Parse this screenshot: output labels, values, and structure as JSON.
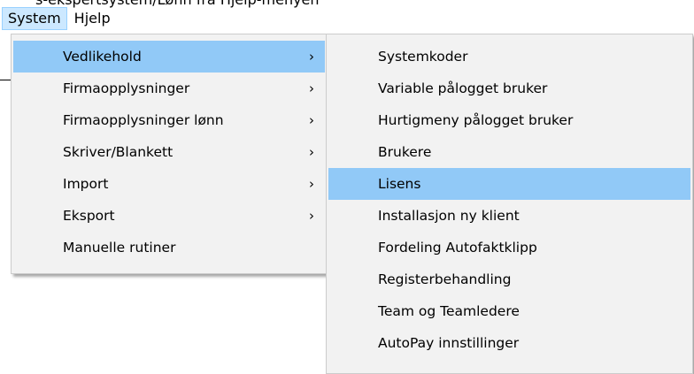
{
  "background": {
    "partial_text": "s-ekspertsystem/Lønn fra Hjelp-menyen"
  },
  "menubar": {
    "items": [
      {
        "label": "System",
        "active": true
      },
      {
        "label": "Hjelp",
        "active": false
      }
    ]
  },
  "main_menu": {
    "items": [
      {
        "label": "Vedlikehold",
        "submenu": true,
        "selected": true
      },
      {
        "label": "Firmaopplysninger",
        "submenu": true,
        "selected": false
      },
      {
        "label": "Firmaopplysninger lønn",
        "submenu": true,
        "selected": false
      },
      {
        "label": "Skriver/Blankett",
        "submenu": true,
        "selected": false
      },
      {
        "label": "Import",
        "submenu": true,
        "selected": false
      },
      {
        "label": "Eksport",
        "submenu": true,
        "selected": false
      },
      {
        "label": "Manuelle rutiner",
        "submenu": false,
        "selected": false
      }
    ],
    "arrow": "›"
  },
  "sub_menu": {
    "items": [
      {
        "label": "Systemkoder",
        "selected": false
      },
      {
        "label": "Variable pålogget bruker",
        "selected": false
      },
      {
        "label": "Hurtigmeny pålogget bruker",
        "selected": false
      },
      {
        "label": "Brukere",
        "selected": false
      },
      {
        "label": "Lisens",
        "selected": true
      },
      {
        "label": "Installasjon ny klient",
        "selected": false
      },
      {
        "label": "Fordeling Autofaktklipp",
        "selected": false
      },
      {
        "label": "Registerbehandling",
        "selected": false
      },
      {
        "label": "Team og Teamledere",
        "selected": false
      },
      {
        "label": "AutoPay innstillinger",
        "selected": false
      }
    ]
  },
  "colors": {
    "menu_background": "#f2f2f2",
    "selected_item": "#91c9f7",
    "menubar_active": "#cce8ff"
  }
}
